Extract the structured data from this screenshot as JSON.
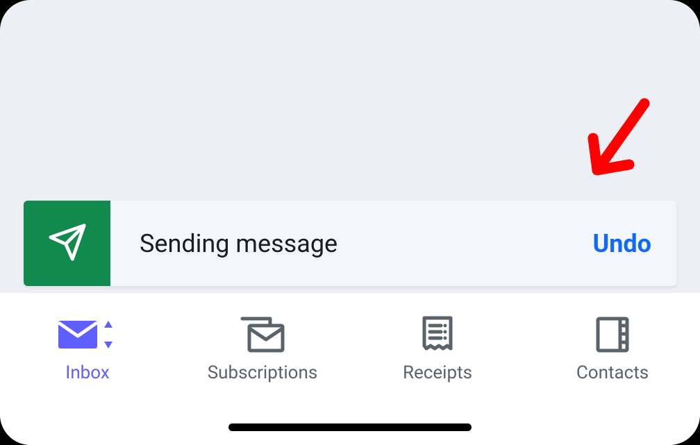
{
  "toast": {
    "message": "Sending message",
    "action_label": "Undo"
  },
  "nav": {
    "items": [
      {
        "label": "Inbox",
        "active": true
      },
      {
        "label": "Subscriptions",
        "active": false
      },
      {
        "label": "Receipts",
        "active": false
      },
      {
        "label": "Contacts",
        "active": false
      }
    ]
  },
  "colors": {
    "accent": "#5f5fff",
    "toast_icon_bg": "#118a4e",
    "link": "#0f69ff",
    "annotation": "#ff0000"
  }
}
